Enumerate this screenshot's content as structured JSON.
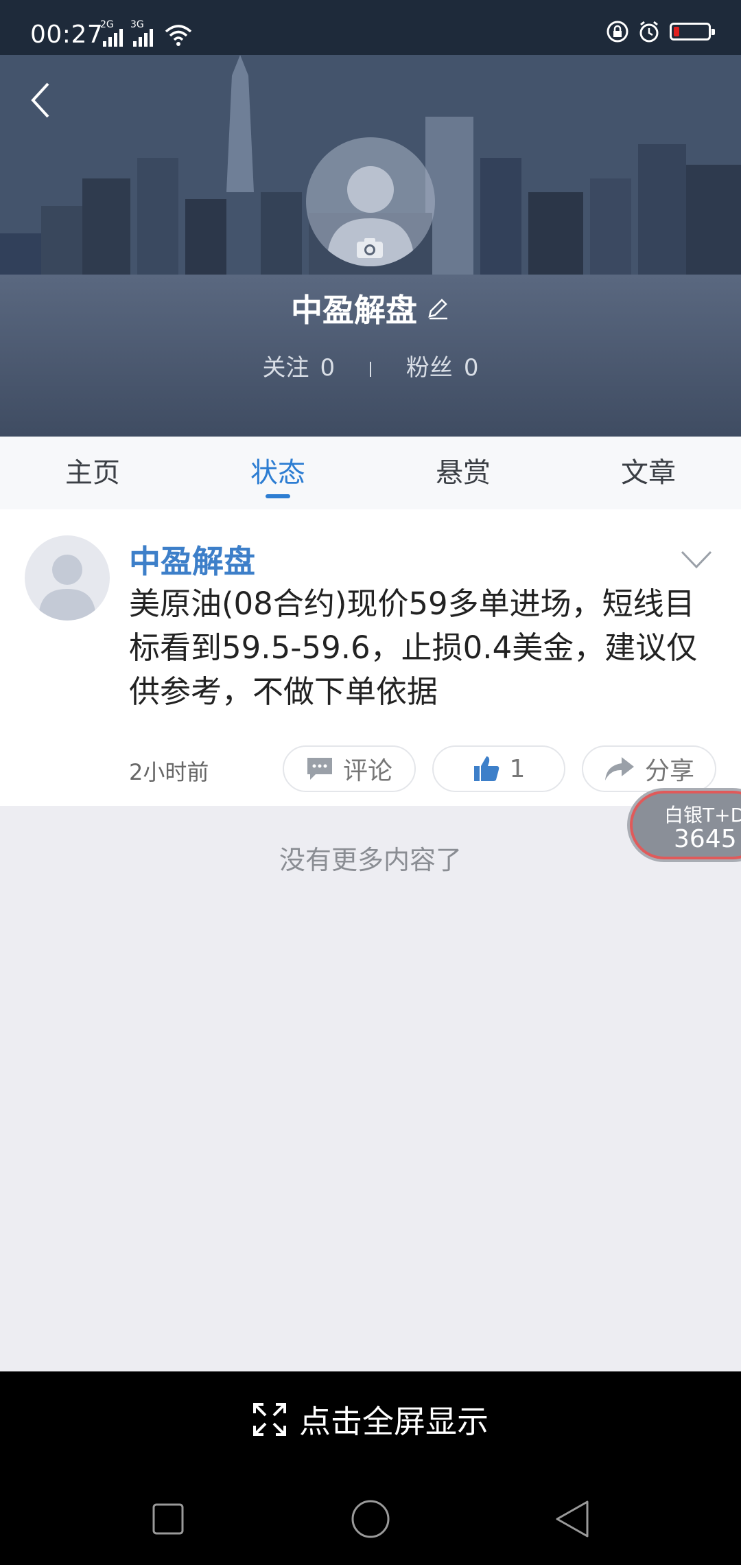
{
  "status_bar": {
    "time": "00:27",
    "net1": "2G",
    "net2": "3G",
    "icons": [
      "signal-icon",
      "signal-icon",
      "wifi-icon",
      "lock-icon",
      "alarm-icon",
      "battery-icon"
    ]
  },
  "profile": {
    "name": "中盈解盘",
    "following_label": "关注",
    "following_count": "0",
    "followers_label": "粉丝",
    "followers_count": "0"
  },
  "tabs": [
    {
      "label": "主页"
    },
    {
      "label": "状态"
    },
    {
      "label": "悬赏"
    },
    {
      "label": "文章"
    }
  ],
  "active_tab": "状态",
  "post": {
    "author": "中盈解盘",
    "text": "美原油(08合约)现价59多单进场，短线目标看到59.5-59.6，止损0.4美金，建议仅供参考，不做下单依据",
    "time": "2小时前",
    "comment_label": "评论",
    "like_count": "1",
    "share_label": "分享"
  },
  "feed_end_text": "没有更多内容了",
  "ticker": {
    "name": "白银T+D",
    "price": "3645"
  },
  "fullscreen_label": "点击全屏显示",
  "colors": {
    "accent": "#2d7dd2",
    "author": "#3d7fc9",
    "ticker_border": "#e05a5a"
  }
}
